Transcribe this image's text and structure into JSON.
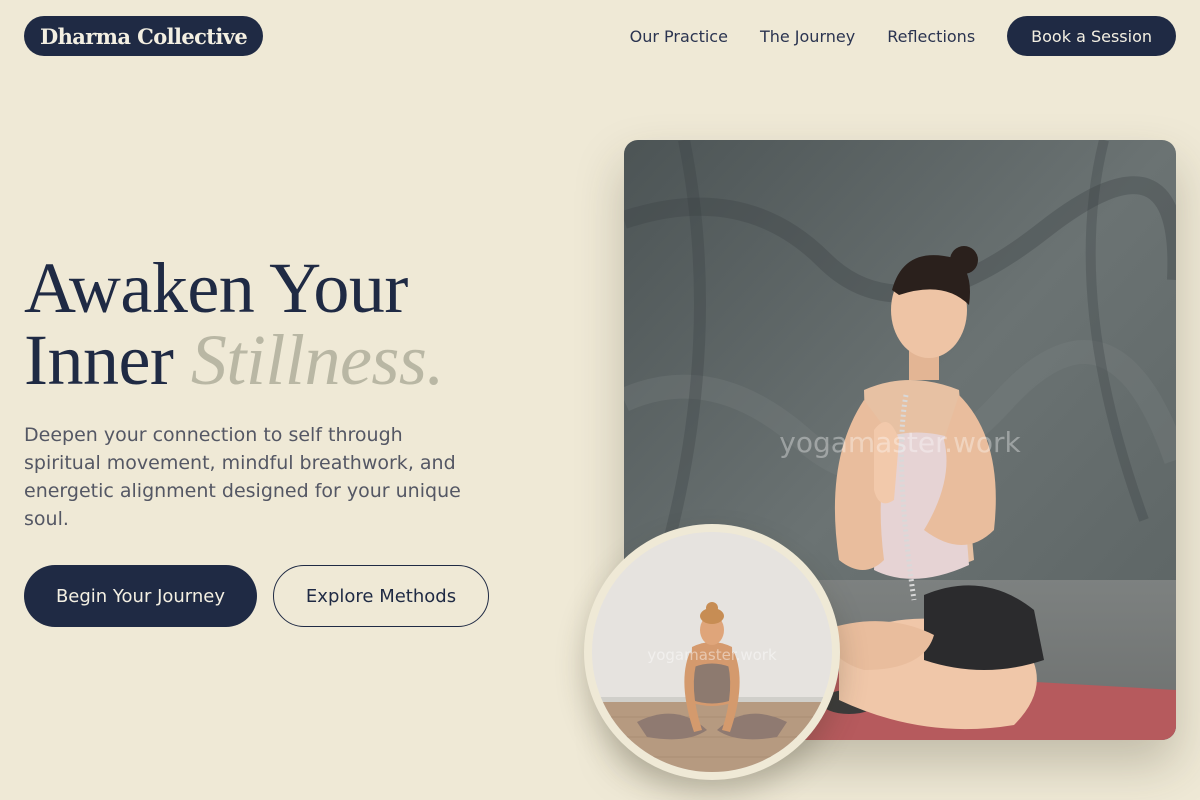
{
  "brand": {
    "name": "Dharma Collective"
  },
  "nav": {
    "items": [
      {
        "label": "Our Practice"
      },
      {
        "label": "The Journey"
      },
      {
        "label": "Reflections"
      }
    ],
    "cta_label": "Book a Session"
  },
  "hero": {
    "headline_line1": "Awaken Your",
    "headline_line2_prefix": "Inner",
    "headline_accent": "Stillness.",
    "description": "Deepen your connection to self through spiritual movement, mindful breathwork, and energetic alignment designed for your unique soul.",
    "primary_button": "Begin Your Journey",
    "secondary_button": "Explore Methods"
  },
  "images": {
    "main_watermark": "yogamaster.work",
    "circle_watermark": "yogamaster.work"
  },
  "colors": {
    "background": "#efe9d6",
    "navy": "#1f2a44",
    "accent_text": "#b9b7a4",
    "body_text": "#545764"
  }
}
